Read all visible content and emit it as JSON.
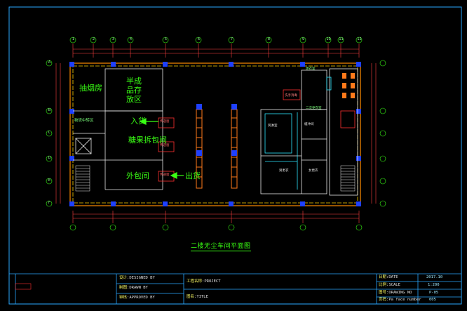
{
  "drawing_title": "二楼无尘车间平面图",
  "rooms": {
    "smoking_room": "抽烟房",
    "semi_storage": [
      "半成",
      "品存",
      "放区"
    ],
    "entry": "入货",
    "inner_pack": "糖果拆包间",
    "outer_pack": "外包间",
    "exit": "出货",
    "left_note": "物流中转区",
    "small_labels": [
      "更衣室",
      "洗手消毒",
      "二次更衣室",
      "风淋室",
      "缓冲间",
      "男更衣",
      "女更衣"
    ],
    "red_tags": [
      "传递窗",
      "传递窗",
      "传递窗"
    ]
  },
  "axis_top": [
    "1",
    "2",
    "3",
    "4",
    "5",
    "6",
    "7",
    "8",
    "9",
    "10",
    "11",
    "12",
    "13"
  ],
  "axis_left": [
    "A",
    "B",
    "C",
    "D",
    "E",
    "F"
  ],
  "title_block": {
    "designed_cn": "设计",
    "designed_en": "DESIGNED BY",
    "drawn_cn": "制图",
    "drawn_en": "DRAWN BY",
    "approved_cn": "审核",
    "approved_en": "APPROVED BY",
    "project_cn": "工程名称",
    "project_en": "PROJECT",
    "title_cn": "图名",
    "title_en": "TITLE",
    "date_cn": "日期",
    "date_en": "DATE",
    "date_val": "2017.10",
    "scale_cn": "比例",
    "scale_en": "SCALE",
    "scale_val": "1:200",
    "drawing_no_cn": "图号",
    "drawing_no_en": "DRAWING NO",
    "drawing_no_val": "P-05",
    "page_cn": "页码",
    "page_en": "Pa face number",
    "page_val": "005"
  }
}
